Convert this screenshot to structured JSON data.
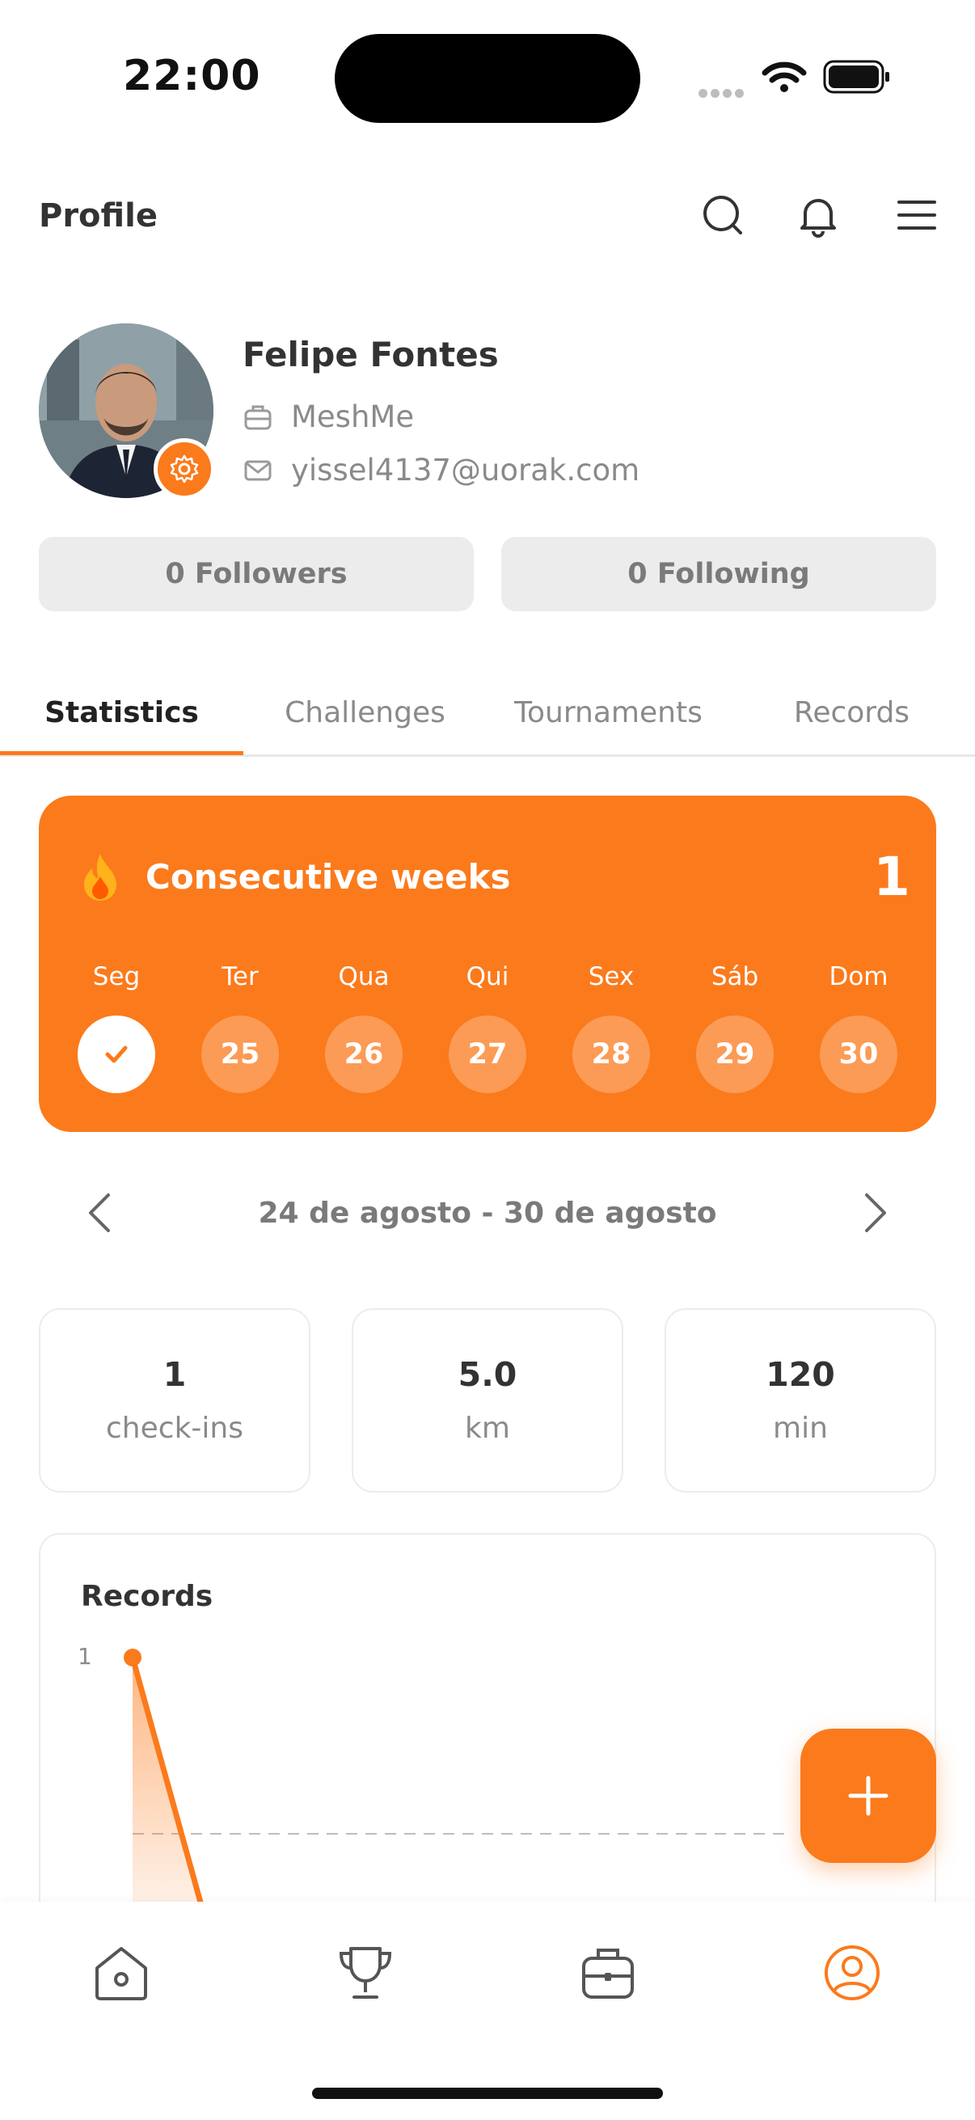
{
  "status_bar": {
    "time": "22:00"
  },
  "header": {
    "title": "Profile"
  },
  "profile": {
    "name": "Felipe Fontes",
    "company": "MeshMe",
    "email": "yissel4137@uorak.com",
    "followers_label": "0 Followers",
    "following_label": "0 Following"
  },
  "tabs": [
    {
      "label": "Statistics",
      "active": true
    },
    {
      "label": "Challenges",
      "active": false
    },
    {
      "label": "Tournaments",
      "active": false
    },
    {
      "label": "Records",
      "active": false
    }
  ],
  "streak": {
    "title": "Consecutive weeks",
    "count": "1",
    "days": [
      {
        "name": "Seg",
        "date": "",
        "done": true
      },
      {
        "name": "Ter",
        "date": "25",
        "done": false
      },
      {
        "name": "Qua",
        "date": "26",
        "done": false
      },
      {
        "name": "Qui",
        "date": "27",
        "done": false
      },
      {
        "name": "Sex",
        "date": "28",
        "done": false
      },
      {
        "name": "Sáb",
        "date": "29",
        "done": false
      },
      {
        "name": "Dom",
        "date": "30",
        "done": false
      }
    ]
  },
  "week_nav": {
    "range": "24 de agosto - 30 de agosto"
  },
  "metrics": [
    {
      "value": "1",
      "unit": "check-ins"
    },
    {
      "value": "5.0",
      "unit": "km"
    },
    {
      "value": "120",
      "unit": "min"
    }
  ],
  "records": {
    "title": "Records",
    "y_tick": "1"
  },
  "colors": {
    "accent": "#fb7a1c",
    "muted": "#8a8a8a"
  }
}
